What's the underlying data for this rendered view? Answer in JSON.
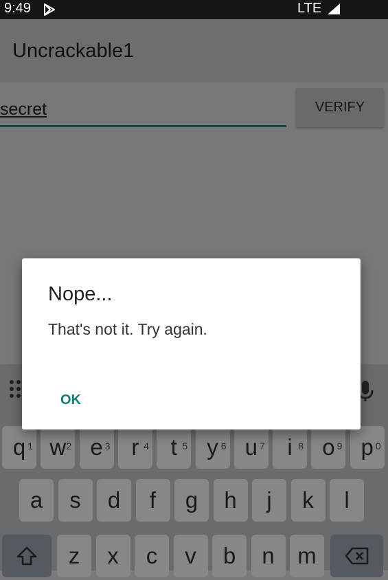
{
  "status_bar": {
    "time": "9:49",
    "network": "LTE",
    "play_icon": "play-store-icon",
    "signal_icon": "signal-icon"
  },
  "app_bar": {
    "title": "Uncrackable1"
  },
  "form": {
    "secret_value": "secret",
    "verify_label": "VERIFY"
  },
  "dialog": {
    "title": "Nope...",
    "message": "That's not it. Try again.",
    "ok_label": "OK"
  },
  "keyboard": {
    "row1": [
      {
        "k": "q",
        "n": "1"
      },
      {
        "k": "w",
        "n": "2"
      },
      {
        "k": "e",
        "n": "3"
      },
      {
        "k": "r",
        "n": "4"
      },
      {
        "k": "t",
        "n": "5"
      },
      {
        "k": "y",
        "n": "6"
      },
      {
        "k": "u",
        "n": "7"
      },
      {
        "k": "i",
        "n": "8"
      },
      {
        "k": "o",
        "n": "9"
      },
      {
        "k": "p",
        "n": "0"
      }
    ],
    "row2": [
      "a",
      "s",
      "d",
      "f",
      "g",
      "h",
      "j",
      "k",
      "l"
    ],
    "row3": [
      "z",
      "x",
      "c",
      "v",
      "b",
      "n",
      "m"
    ],
    "icons": [
      "app-grid-icon",
      "mic-icon",
      "shift-icon",
      "backspace-icon"
    ]
  },
  "colors": {
    "accent": "#0d7f73",
    "input_underline": "#114b44",
    "scrim": "#7a7a7a"
  }
}
